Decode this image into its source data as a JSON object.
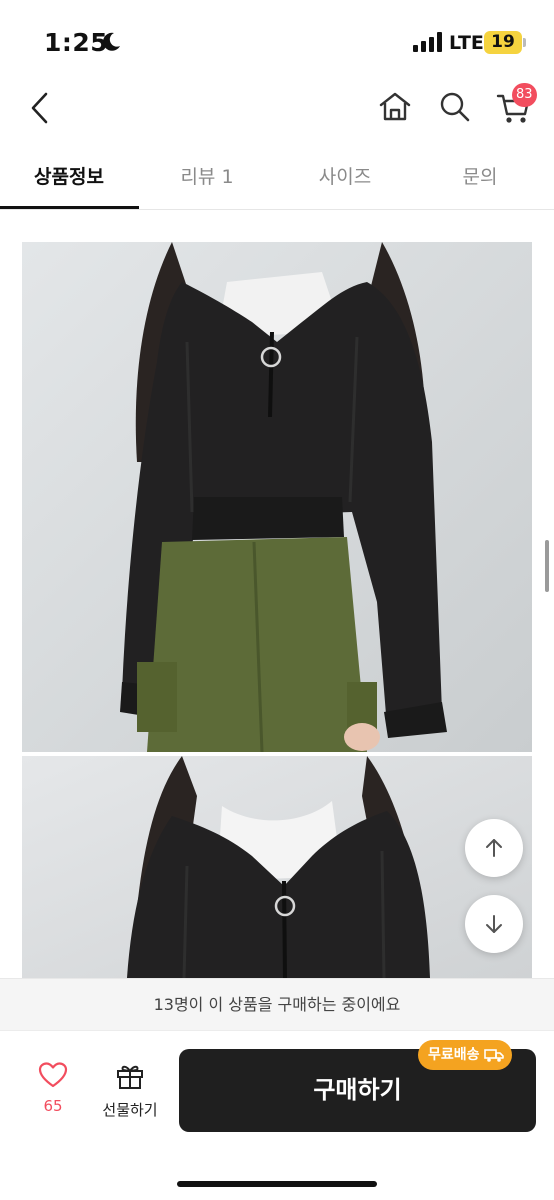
{
  "status_bar": {
    "time": "1:25",
    "network": "LTE",
    "battery": "19"
  },
  "nav": {
    "icons": [
      "chevron-left-icon",
      "home-icon",
      "search-icon",
      "cart-icon"
    ],
    "cart_badge": "83"
  },
  "tabs": [
    {
      "label": "상품정보",
      "active": true
    },
    {
      "label": "리뷰 1",
      "active": false
    },
    {
      "label": "사이즈",
      "active": false
    },
    {
      "label": "문의",
      "active": false
    }
  ],
  "floating_buttons": [
    "arrow-up-icon",
    "arrow-down-icon"
  ],
  "notice": "13명이 이 상품을 구매하는 중이에요",
  "bottom_bar": {
    "like_count": "65",
    "gift_label": "선물하기",
    "buy_label": "구매하기",
    "free_shipping_badge": "무료배송"
  },
  "colors": {
    "accent_red": "#f24d5e",
    "badge_orange": "#f4a320",
    "buy_button": "#1f1f1f"
  }
}
